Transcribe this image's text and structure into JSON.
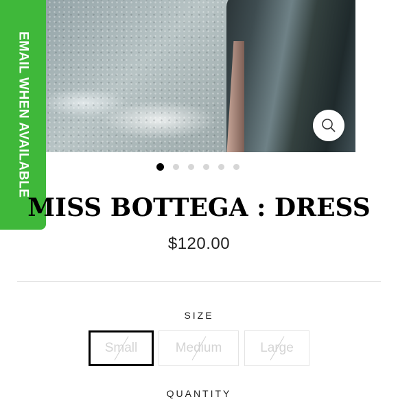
{
  "email_tab": {
    "label": "EMAIL WHEN AVAILABLE"
  },
  "product": {
    "title": "MISS BOTTEGA : DRESS",
    "price": "$120.00"
  },
  "gallery": {
    "image_count": 6,
    "active_index": 0
  },
  "size": {
    "label": "SIZE",
    "options": [
      "Small",
      "Medium",
      "Large"
    ],
    "selected": "Small",
    "all_unavailable": true
  },
  "quantity": {
    "label": "QUANTITY"
  },
  "colors": {
    "email_tab": "#3fb83a",
    "selected_border": "#000000",
    "unavailable_text": "#d4d4d4"
  },
  "icons": {
    "zoom": "magnifier-icon"
  }
}
